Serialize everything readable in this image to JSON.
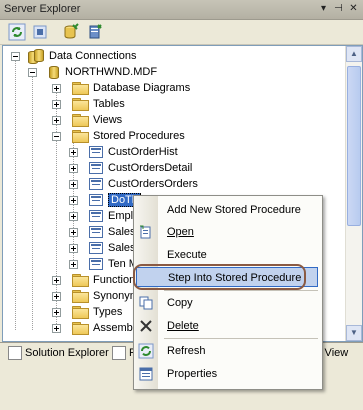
{
  "window": {
    "title": "Server Explorer"
  },
  "title_buttons": [
    {
      "name": "dropdown",
      "glyph": "▾"
    },
    {
      "name": "pin",
      "glyph": "⊣"
    },
    {
      "name": "close",
      "glyph": "✕"
    }
  ],
  "toolbar": {
    "refresh_icon": "refresh-icon",
    "connect_db_icon": "connect-database-icon",
    "connect_server_icon": "connect-server-icon"
  },
  "tree": {
    "data_connections": "Data Connections",
    "db_file": "NORTHWND.MDF",
    "database_diagrams": "Database Diagrams",
    "tables": "Tables",
    "views": "Views",
    "stored_procedures": "Stored Procedures",
    "procs": {
      "p1": "CustOrderHist",
      "p2": "CustOrdersDetail",
      "p3": "CustOrdersOrders",
      "p4": "DoTh",
      "p5": "Emplo",
      "p6": "Sales",
      "p7": "Sales",
      "p8": "Ten M"
    },
    "functions": "Functions",
    "synonyms": "Synonym",
    "types": "Types",
    "assemblies": "Assemblie"
  },
  "context_menu": {
    "add_new": "Add New Stored Procedure",
    "open": "Open",
    "execute": "Execute",
    "step_into": "Step Into Stored Procedure",
    "copy": "Copy",
    "delete": "Delete",
    "refresh": "Refresh",
    "properties": "Properties"
  },
  "tabs": {
    "solution_explorer": "Solution Explorer",
    "tab_p": "P",
    "s_view": "s View"
  },
  "colors": {
    "selection": "#316ac5",
    "highlight_ring": "#8a5a43"
  }
}
